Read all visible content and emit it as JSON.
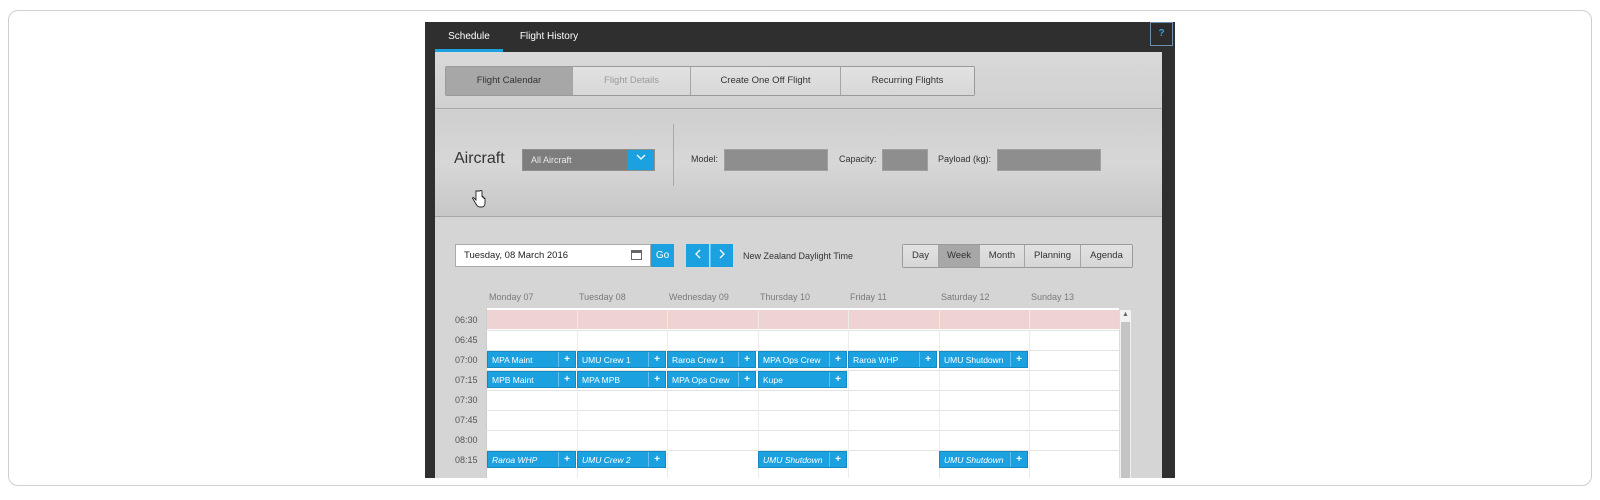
{
  "tabs": [
    {
      "label": "Schedule",
      "active": true
    },
    {
      "label": "Flight History",
      "active": false
    }
  ],
  "help_label": "?",
  "subtabs": [
    {
      "label": "Flight Calendar",
      "state": "active"
    },
    {
      "label": "Flight Details",
      "state": "disabled"
    },
    {
      "label": "Create One Off Flight",
      "state": "normal"
    },
    {
      "label": "Recurring Flights",
      "state": "normal"
    }
  ],
  "aircraft": {
    "title": "Aircraft",
    "select_value": "All Aircraft",
    "model_label": "Model:",
    "model_value": "",
    "capacity_label": "Capacity:",
    "capacity_value": "",
    "payload_label": "Payload (kg):",
    "payload_value": ""
  },
  "calendar": {
    "date_value": "Tuesday, 08 March 2016",
    "go_label": "Go",
    "prev_icon": "chevron-left-icon",
    "next_icon": "chevron-right-icon",
    "timezone": "New Zealand Daylight Time",
    "views": [
      {
        "label": "Day",
        "active": false
      },
      {
        "label": "Week",
        "active": true
      },
      {
        "label": "Month",
        "active": false
      },
      {
        "label": "Planning",
        "active": false
      },
      {
        "label": "Agenda",
        "active": false
      }
    ],
    "days": [
      "Monday 07",
      "Tuesday 08",
      "Wednesday 09",
      "Thursday 10",
      "Friday 11",
      "Saturday 12",
      "Sunday 13"
    ],
    "times": [
      "06:30",
      "06:45",
      "07:00",
      "07:15",
      "07:30",
      "07:45",
      "08:00",
      "08:15"
    ],
    "events": [
      {
        "label": "MPA Maint",
        "day": 0,
        "slot": 2,
        "italic": false
      },
      {
        "label": "UMU Crew 1",
        "day": 1,
        "slot": 2,
        "italic": false
      },
      {
        "label": "Raroa Crew 1",
        "day": 2,
        "slot": 2,
        "italic": false
      },
      {
        "label": "MPA Ops Crew",
        "day": 3,
        "slot": 2,
        "italic": false
      },
      {
        "label": "Raroa WHP",
        "day": 4,
        "slot": 2,
        "italic": false
      },
      {
        "label": "UMU Shutdown",
        "day": 5,
        "slot": 2,
        "italic": false
      },
      {
        "label": "MPB Maint",
        "day": 0,
        "slot": 3,
        "italic": false
      },
      {
        "label": "MPA MPB",
        "day": 1,
        "slot": 3,
        "italic": false
      },
      {
        "label": "MPA Ops Crew",
        "day": 2,
        "slot": 3,
        "italic": false
      },
      {
        "label": "Kupe",
        "day": 3,
        "slot": 3,
        "italic": false
      },
      {
        "label": "Raroa WHP",
        "day": 0,
        "slot": 7,
        "italic": true
      },
      {
        "label": "UMU Crew 2",
        "day": 1,
        "slot": 7,
        "italic": true
      },
      {
        "label": "UMU Shutdown",
        "day": 3,
        "slot": 7,
        "italic": true
      },
      {
        "label": "UMU Shutdown",
        "day": 5,
        "slot": 7,
        "italic": true
      }
    ],
    "event_plus": "+"
  },
  "colors": {
    "accent": "#1ca1e0",
    "chrome": "#2f2f2f",
    "highlight_band": "#efd3d3"
  }
}
